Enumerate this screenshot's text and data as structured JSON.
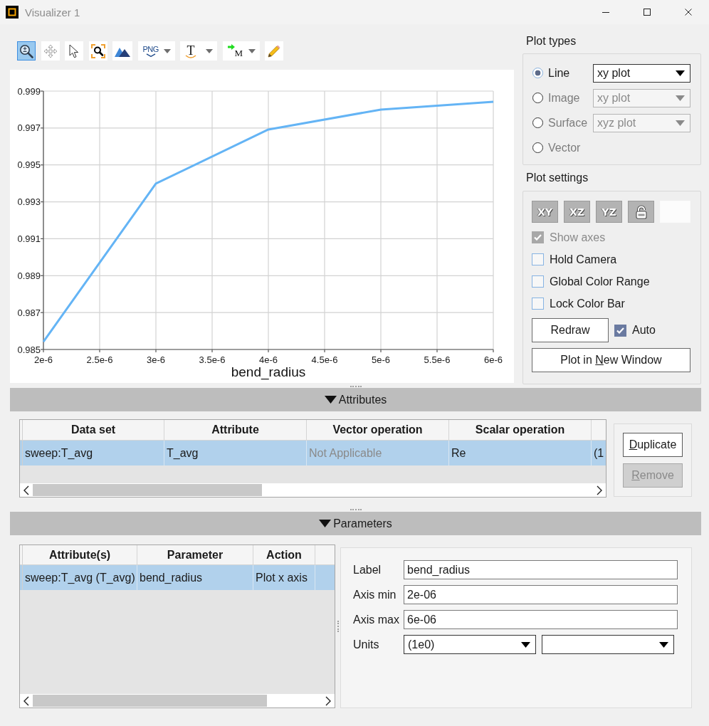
{
  "window": {
    "title": "Visualizer 1",
    "controls": [
      {
        "kind": "minimize"
      },
      {
        "kind": "maximize"
      },
      {
        "kind": "close"
      }
    ]
  },
  "toolbar": [
    {
      "kind": "zoom",
      "selected": true,
      "menu": false
    },
    {
      "kind": "pan",
      "selected": false,
      "menu": false
    },
    {
      "kind": "pointer",
      "selected": false,
      "menu": false
    },
    {
      "kind": "zoom-box",
      "selected": false,
      "menu": false
    },
    {
      "kind": "peaks",
      "selected": false,
      "menu": false
    },
    {
      "kind": "export",
      "text": "PNG",
      "selected": false,
      "menu": true
    },
    {
      "kind": "text",
      "text": "T",
      "selected": false,
      "menu": true
    },
    {
      "kind": "marker",
      "text": "M",
      "selected": false,
      "menu": true
    },
    {
      "kind": "pencil",
      "selected": false,
      "menu": false
    }
  ],
  "chart": {
    "chart_data": {
      "type": "line",
      "grid": true,
      "xlabel": "bend_radius",
      "x": [
        2e-06,
        3e-06,
        4e-06,
        5e-06,
        6e-06
      ],
      "values": [
        0.98542,
        0.99399,
        0.99692,
        0.998,
        0.99842
      ],
      "xlim": [
        2e-06,
        6e-06
      ],
      "ylim": [
        0.985,
        0.999
      ],
      "xticks": [
        {
          "value": 2e-06,
          "label": "2e-6"
        },
        {
          "value": 2.5e-06,
          "label": "2.5e-6"
        },
        {
          "value": 3e-06,
          "label": "3e-6"
        },
        {
          "value": 3.5e-06,
          "label": "3.5e-6"
        },
        {
          "value": 4e-06,
          "label": "4e-6"
        },
        {
          "value": 4.5e-06,
          "label": "4.5e-6"
        },
        {
          "value": 5e-06,
          "label": "5e-6"
        },
        {
          "value": 5.5e-06,
          "label": "5.5e-6"
        },
        {
          "value": 6e-06,
          "label": "6e-6"
        }
      ],
      "yticks": [
        {
          "value": 0.985,
          "label": "0.985"
        },
        {
          "value": 0.987,
          "label": "0.987"
        },
        {
          "value": 0.989,
          "label": "0.989"
        },
        {
          "value": 0.991,
          "label": "0.991"
        },
        {
          "value": 0.993,
          "label": "0.993"
        },
        {
          "value": 0.995,
          "label": "0.995"
        },
        {
          "value": 0.997,
          "label": "0.997"
        },
        {
          "value": 0.999,
          "label": "0.999"
        }
      ]
    }
  },
  "plot_types": {
    "title": "Plot types",
    "options": [
      {
        "label": "Line",
        "selected": true,
        "disabled": false,
        "dropdown": {
          "value": "xy plot",
          "disabled": false
        }
      },
      {
        "label": "Image",
        "selected": false,
        "disabled": true,
        "dropdown": {
          "value": "xy plot",
          "disabled": true
        }
      },
      {
        "label": "Surface",
        "selected": false,
        "disabled": true,
        "dropdown": {
          "value": "xyz plot",
          "disabled": true
        }
      },
      {
        "label": "Vector",
        "selected": false,
        "disabled": true
      }
    ]
  },
  "plot_settings": {
    "title": "Plot settings",
    "view_buttons": [
      {
        "kind": "text",
        "text": "XY"
      },
      {
        "kind": "text",
        "text": "XZ"
      },
      {
        "kind": "text",
        "text": "YZ"
      },
      {
        "kind": "lock"
      },
      {
        "kind": "blank"
      }
    ],
    "checkboxes": [
      {
        "label": "Show axes",
        "checked": true,
        "disabled": true
      },
      {
        "label": "Hold Camera",
        "checked": false,
        "disabled": false
      },
      {
        "label": "Global Color Range",
        "checked": false,
        "disabled": false
      },
      {
        "label": "Lock Color Bar",
        "checked": false,
        "disabled": false
      }
    ],
    "redraw": {
      "label": "Redraw"
    },
    "auto": {
      "label": "Auto",
      "checked": true
    },
    "new_window": {
      "label_parts": [
        {
          "text": "Plot in ",
          "access_key": false
        },
        {
          "text": "N",
          "access_key": true
        },
        {
          "text": "ew Window",
          "access_key": false
        }
      ]
    }
  },
  "attributes": {
    "title": "Attributes",
    "expanded": true,
    "table": {
      "columns": [
        "Data set",
        "Attribute",
        "Vector operation",
        "Scalar operation"
      ],
      "rows": [
        {
          "selected": true,
          "cells": [
            {
              "text": "sweep:T_avg",
              "disabled": false
            },
            {
              "text": "T_avg",
              "disabled": false
            },
            {
              "text": "Not Applicable",
              "disabled": true
            },
            {
              "text": "Re",
              "disabled": false
            },
            {
              "text": "(1",
              "disabled": false
            }
          ]
        }
      ]
    },
    "buttons": [
      {
        "label_parts": [
          {
            "text": "D",
            "access_key": true
          },
          {
            "text": "uplicate",
            "access_key": false
          }
        ],
        "disabled": false
      },
      {
        "label_parts": [
          {
            "text": "R",
            "access_key": true
          },
          {
            "text": "emove",
            "access_key": false
          }
        ],
        "disabled": true
      }
    ]
  },
  "parameters": {
    "title": "Parameters",
    "expanded": true,
    "table": {
      "columns": [
        "Attribute(s)",
        "Parameter",
        "Action"
      ],
      "rows": [
        {
          "selected": true,
          "cells": [
            {
              "text": "sweep:T_avg (T_avg)",
              "disabled": false
            },
            {
              "text": "bend_radius",
              "disabled": false
            },
            {
              "text": "Plot x axis",
              "disabled": false
            }
          ]
        }
      ]
    },
    "form": {
      "fields": [
        {
          "kind": "text",
          "label": "Label",
          "value": "bend_radius"
        },
        {
          "kind": "text",
          "label": "Axis min",
          "value": "2e-06"
        },
        {
          "kind": "text",
          "label": "Axis max",
          "value": "6e-06"
        },
        {
          "kind": "dropdowns",
          "label": "Units",
          "dropdowns": [
            {
              "value": "(1e0)",
              "disabled": false
            },
            {
              "disabled": false
            }
          ]
        }
      ]
    }
  }
}
